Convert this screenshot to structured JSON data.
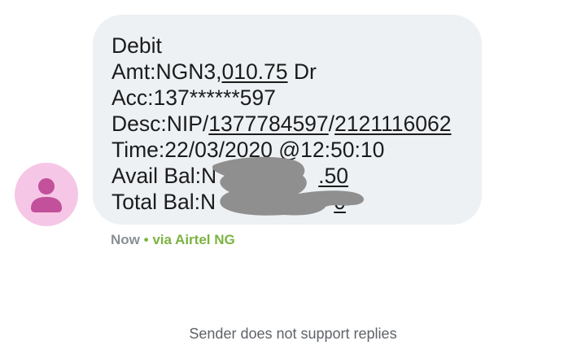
{
  "message": {
    "line1": "Debit",
    "amount_prefix": "Amt:NGN3,",
    "amount_link": "010.75",
    "amount_suffix": " Dr",
    "account": "Acc:137******597",
    "desc_prefix": "Desc:NIP/",
    "desc_link1": "1377784597",
    "desc_sep": "/",
    "desc_link2": "2121116062",
    "time": "Time:22/03/2020 @12:50:10",
    "avail_prefix": "Avail Bal:N",
    "avail_link": ".50",
    "total_prefix": "Total Bal:N",
    "total_link": "0"
  },
  "status": {
    "time": "Now",
    "separator": "•",
    "via": "via Airtel NG"
  },
  "footer": {
    "notice": "Sender does not support replies"
  },
  "colors": {
    "bubble": "#eef1f4",
    "avatar_bg": "#f6c6e6",
    "avatar_icon": "#c2509b",
    "via_green": "#7cb342",
    "redaction": "#8f8f8f"
  },
  "icons": {
    "avatar": "person-icon"
  }
}
